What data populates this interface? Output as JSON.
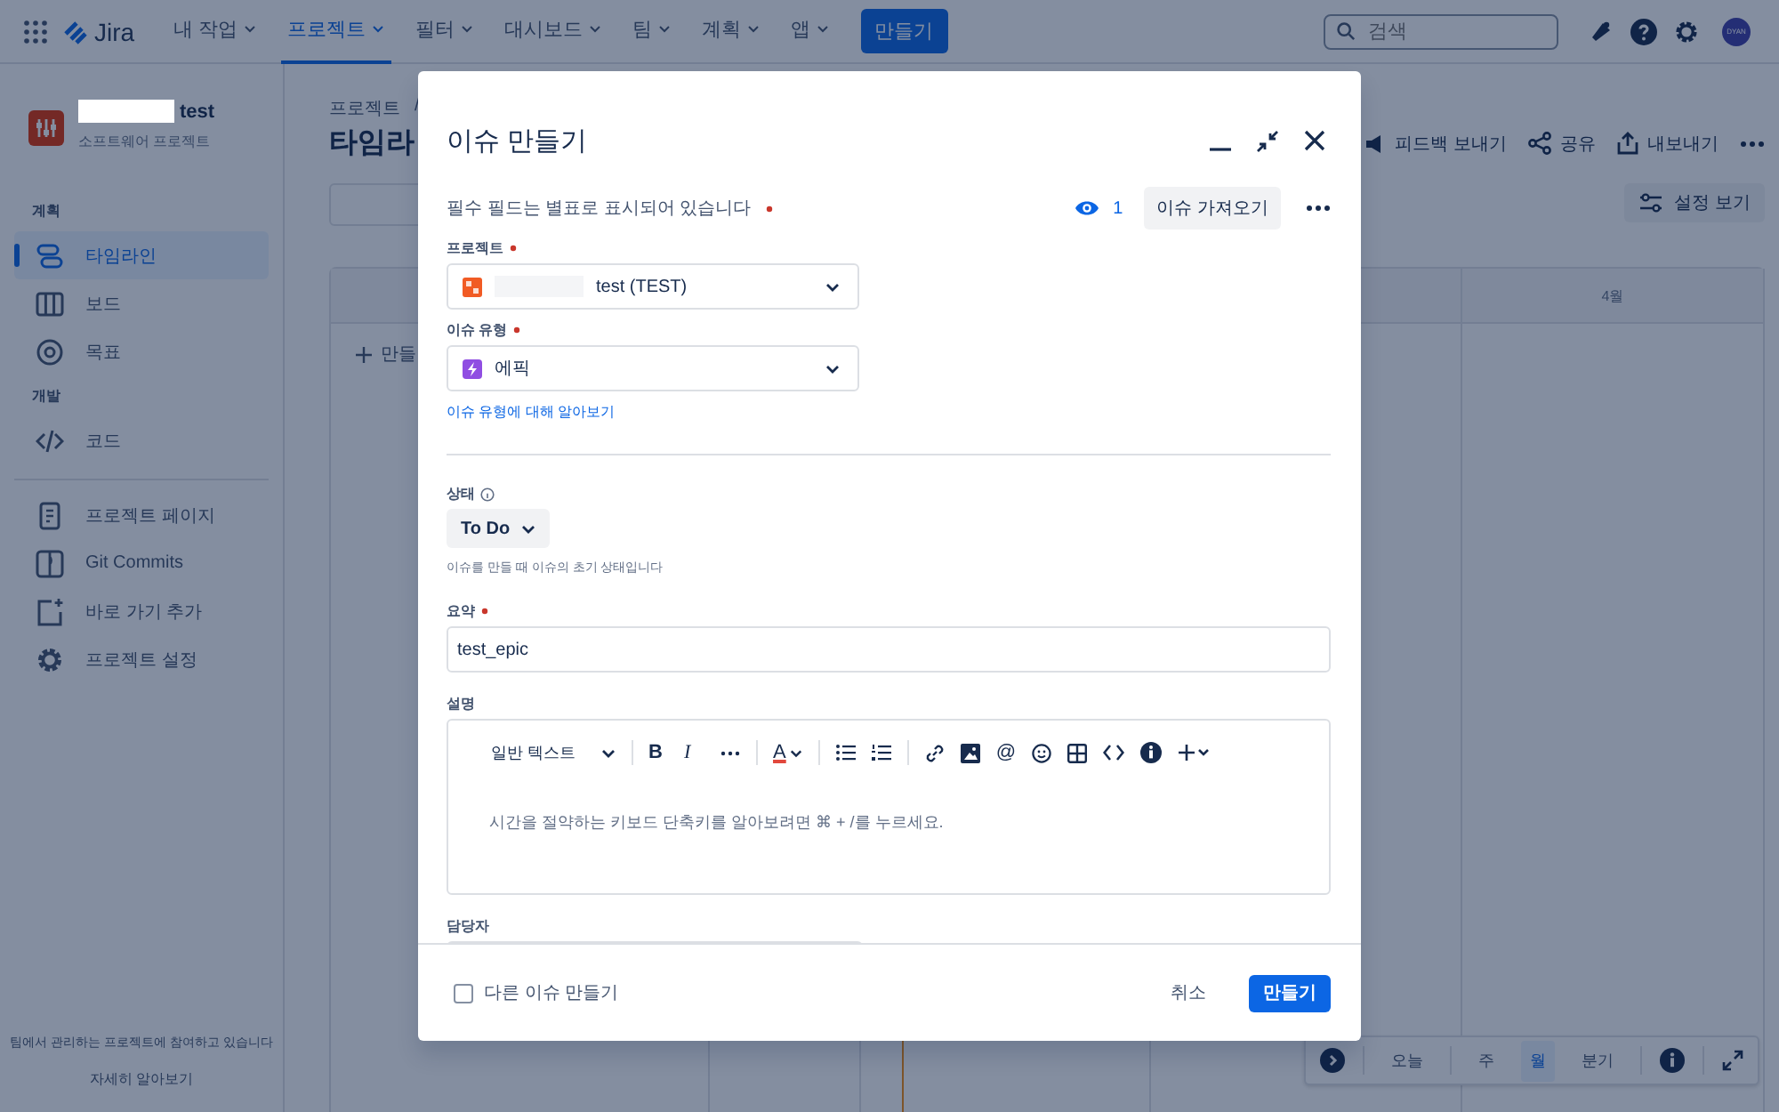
{
  "top_nav": {
    "logo": "Jira",
    "nav_items": [
      {
        "label": "내 작업",
        "selected": false
      },
      {
        "label": "프로젝트",
        "selected": true
      },
      {
        "label": "필터",
        "selected": false
      },
      {
        "label": "대시보드",
        "selected": false
      },
      {
        "label": "팀",
        "selected": false
      },
      {
        "label": "계획",
        "selected": false
      },
      {
        "label": "앱",
        "selected": false
      }
    ],
    "create_button": "만들기",
    "search": {
      "placeholder": "검색"
    },
    "avatar": "DYAN"
  },
  "sidebar": {
    "project": {
      "redacted": true,
      "name": "test",
      "type": "소프트웨어 프로젝트"
    },
    "groups": [
      {
        "heading": "계획",
        "items": [
          {
            "label": "타임라인",
            "selected": true
          },
          {
            "label": "보드",
            "selected": false
          },
          {
            "label": "목표",
            "selected": false
          }
        ]
      },
      {
        "heading": "개발",
        "items": [
          {
            "label": "코드",
            "selected": false
          }
        ]
      },
      {
        "items": [
          {
            "label": "프로젝트 페이지",
            "selected": false
          },
          {
            "label": "Git Commits",
            "selected": false
          },
          {
            "label": "바로 가기 추가",
            "selected": false
          },
          {
            "label": "프로젝트 설정",
            "selected": false
          }
        ]
      }
    ],
    "footer_note": "팀에서 관리하는 프로젝트에 참여하고 있습니다",
    "footer_link": "자세히 알아보기"
  },
  "timeline": {
    "breadcrumb": "프로젝트",
    "breadcrumb_separator": "/",
    "title": "타임라",
    "actions": [
      "피드백 보내기",
      "공유",
      "내보내기"
    ],
    "view_settings": "설정 보기",
    "month": "4월",
    "create": "만들",
    "zoom": {
      "today": "오늘",
      "scales": [
        {
          "label": "주",
          "selected": false
        },
        {
          "label": "월",
          "selected": true
        },
        {
          "label": "분기",
          "selected": false
        }
      ]
    }
  },
  "dialog": {
    "title": "이슈 만들기",
    "required_note": "필수 필드는 별표로 표시되어 있습니다",
    "watchers": "1",
    "import_button": "이슈 가져오기",
    "fields": [
      {
        "kind": "select",
        "label": "프로젝트",
        "required": true,
        "redacted": true,
        "value": "test (TEST)"
      },
      {
        "kind": "select",
        "label": "이슈 유형",
        "required": true,
        "value": "에픽",
        "link": "이슈 유형에 대해 알아보기"
      },
      {
        "kind": "status",
        "label": "상태",
        "required": false,
        "value": "To Do",
        "help": "이슈를 만들 때 이슈의 초기 상태입니다"
      },
      {
        "kind": "text",
        "label": "요약",
        "required": true,
        "value": "test_epic"
      },
      {
        "kind": "editor",
        "label": "설명",
        "required": false,
        "text_style": "일반 텍스트",
        "bold": "B",
        "italic": "I",
        "text_color_button": "A",
        "mention": "@",
        "placeholder": "시간을 절약하는 키보드 단축키를 알아보려면 ⌘ + /를 누르세요."
      },
      {
        "kind": "partial",
        "label": "담당자",
        "required": false
      }
    ],
    "footer": {
      "create_another": {
        "label": "다른 이슈 만들기",
        "checked": false
      },
      "cancel": "취소",
      "submit": "만들기"
    }
  }
}
